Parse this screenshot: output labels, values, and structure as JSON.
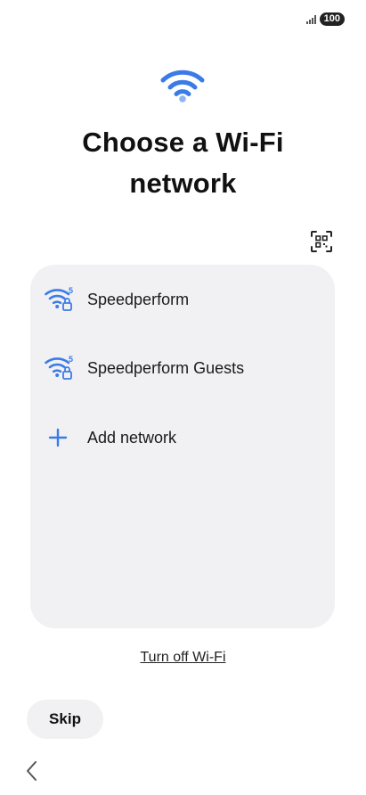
{
  "status_bar": {
    "battery": "100",
    "signal_icon": "cellular-signal-icon"
  },
  "header": {
    "icon": "wifi-icon",
    "title_line1": "Choose a Wi-Fi",
    "title_line2": "network"
  },
  "qr_scan": {
    "icon": "qr-code-scan-icon"
  },
  "networks": [
    {
      "label": "Speedperform",
      "icon": "wifi-5ghz-secured-icon"
    },
    {
      "label": "Speedperform Guests",
      "icon": "wifi-5ghz-secured-icon"
    }
  ],
  "add_network": {
    "label": "Add network",
    "icon": "plus-icon"
  },
  "turn_off_label": "Turn off Wi-Fi",
  "skip_label": "Skip",
  "nav": {
    "back_icon": "chevron-left-icon"
  },
  "colors": {
    "accent": "#3b7be8",
    "card_bg": "#f1f1f3",
    "text": "#111111"
  }
}
